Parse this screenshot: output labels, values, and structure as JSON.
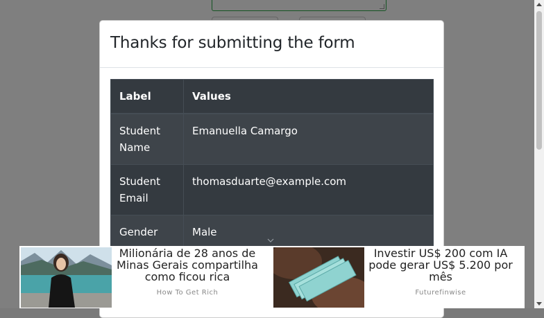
{
  "modal": {
    "title": "Thanks for submitting the form"
  },
  "table": {
    "headers": [
      "Label",
      "Values"
    ],
    "rows": [
      {
        "label": "Student Name",
        "value": "Emanuella Camargo"
      },
      {
        "label": "Student Email",
        "value": "thomasduarte@example.com"
      },
      {
        "label": "Gender",
        "value": "Male"
      }
    ]
  },
  "ads": [
    {
      "headline": "Milionária de 28 anos de Minas Gerais compartilha como ficou rica",
      "source": "How To Get Rich"
    },
    {
      "headline": "Investir US$ 200 com IA pode gerar US$ 5.200 por mês",
      "source": "Futurefinwise"
    }
  ],
  "icons": {
    "chevron": "chevron-down-icon"
  }
}
